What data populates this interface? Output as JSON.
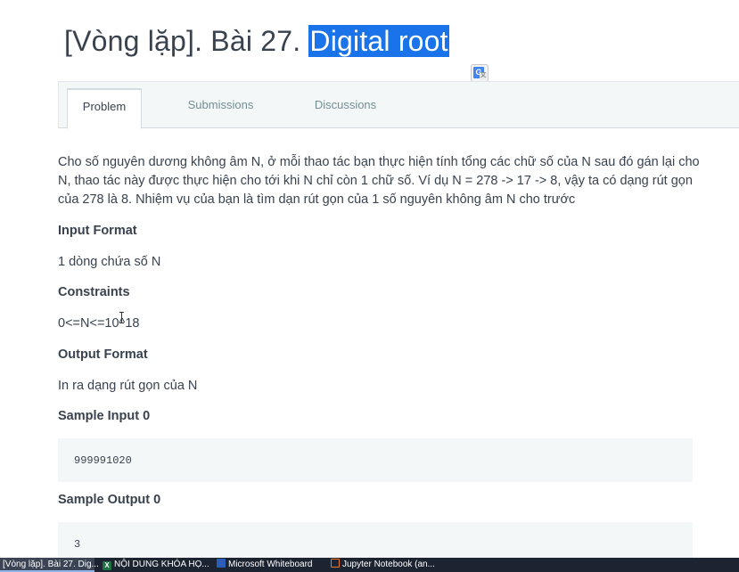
{
  "page": {
    "title_prefix": "[Vòng lặp]. Bài 27. ",
    "title_highlight": "Digital root"
  },
  "translate_icon": {
    "name": "google-translate-icon",
    "glyph": "G",
    "sub": "文"
  },
  "tabs": [
    {
      "label": "Problem",
      "active": true
    },
    {
      "label": "Submissions",
      "active": false
    },
    {
      "label": "Discussions",
      "active": false
    }
  ],
  "problem": {
    "description": "Cho số nguyên dương không âm N, ở mỗi thao tác bạn thực hiện tính tổng các chữ số của N sau đó gán lại cho N, thao tác này được thực hiện cho tới khi N chỉ còn 1 chữ số. Ví dụ N = 278 -> 17 -> 8, vậy ta có dạng rút gọn của 278 là 8. Nhiệm vụ của bạn là tìm dạn rút gọn của 1 số nguyên không âm N cho trước",
    "input_format_heading": "Input Format",
    "input_format": "1 dòng chứa số N",
    "constraints_heading": "Constraints",
    "constraints": "0<=N<=10^18",
    "output_format_heading": "Output Format",
    "output_format": "In ra dạng rút gọn của N",
    "sample_input_heading": "Sample Input 0",
    "sample_input": "999991020",
    "sample_output_heading": "Sample Output 0",
    "sample_output": "3"
  },
  "taskbar": [
    {
      "label": "[Vòng lặp]. Bài 27. Dig...",
      "icon": "chrome-icon",
      "active": true
    },
    {
      "label": "NỘI DUNG KHÓA HỌ...",
      "icon": "excel-icon",
      "active": false
    },
    {
      "label": "Microsoft Whiteboard",
      "icon": "whiteboard-icon",
      "active": false
    },
    {
      "label": "Jupyter Notebook (an...",
      "icon": "jupyter-icon",
      "active": false
    }
  ],
  "colors": {
    "highlight": "#1a73e8",
    "text": "#39424e",
    "tab_inactive": "#738f93",
    "code_bg": "#f3f7f7",
    "taskbar": "#1c2431"
  }
}
